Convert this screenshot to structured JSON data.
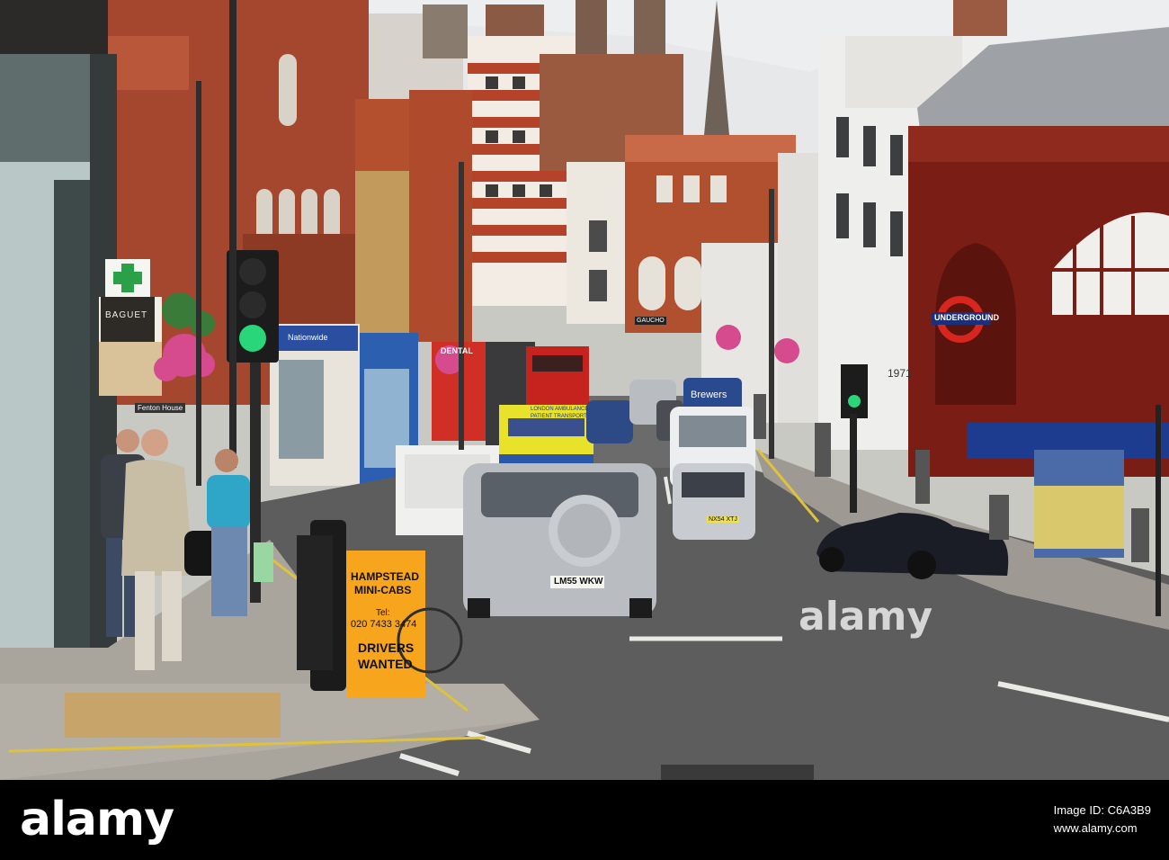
{
  "photo": {
    "subject": "street-scene",
    "signs": {
      "minicab_line1": "HAMPSTEAD",
      "minicab_line2": "MINI-CABS",
      "minicab_tel_label": "Tel:",
      "minicab_tel": "020 7433 3474",
      "minicab_line3": "DRIVERS",
      "minicab_line4": "WANTED",
      "underground": "UNDERGROUND",
      "baguet": "BAGUET",
      "fenton": "Fenton House",
      "nationwide": "Nationwide",
      "dental": "DENTAL",
      "brewers": "Brewers",
      "gaucho": "GAUCHO",
      "ambulance_line1": "LONDON AMBULANCE",
      "ambulance_line2": "PATIENT TRANSPORT",
      "plate_main": "LM55 WKW",
      "plate_van": "NX54 XTJ",
      "shop_1971": "1971"
    },
    "colors": {
      "sky": "#e6e8ea",
      "brick": "#a5472f",
      "tile_red": "#7a1d14",
      "signal_green": "#29d67a",
      "sign_orange": "#f7a51c",
      "bus_red": "#c6231e",
      "ambulance_yellow": "#e9e22b"
    }
  },
  "watermark": "alamy",
  "footer": {
    "logo": "alamy",
    "image_id_label": "Image ID: C6A3B9",
    "url": "www.alamy.com"
  }
}
